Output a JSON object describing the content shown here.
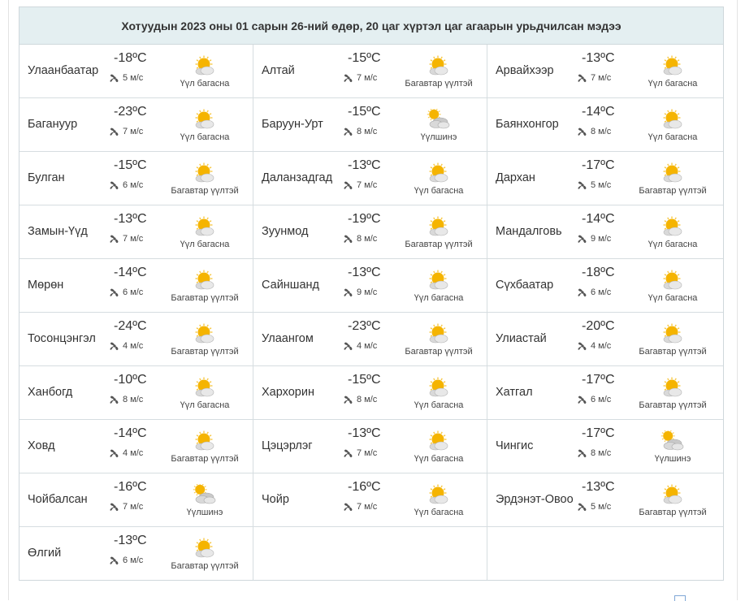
{
  "title": "Хотуудын 2023 оны 01 сарын 26-ний өдөр, 20 цаг хүртэл цаг агаарын урьдчилсан мэдээ",
  "cities": [
    {
      "name": "Улаанбаатар",
      "temp": "-18ºC",
      "wind": "5 м/с",
      "desc": "Үүл багасна",
      "icon": "sun-cloud-icon"
    },
    {
      "name": "Алтай",
      "temp": "-15ºC",
      "wind": "7 м/с",
      "desc": "Багавтар үүлтэй",
      "icon": "sun-cloud-icon"
    },
    {
      "name": "Арвайхээр",
      "temp": "-13ºC",
      "wind": "7 м/с",
      "desc": "Үүл багасна",
      "icon": "sun-cloud-icon"
    },
    {
      "name": "Баганууp",
      "temp": "-23ºC",
      "wind": "7 м/с",
      "desc": "Үүл багасна",
      "icon": "sun-cloud-icon"
    },
    {
      "name": "Баруун-Урт",
      "temp": "-15ºC",
      "wind": "8 м/с",
      "desc": "Үүлшинэ",
      "icon": "cloudy-icon"
    },
    {
      "name": "Баянхонгор",
      "temp": "-14ºC",
      "wind": "8 м/с",
      "desc": "Үүл багасна",
      "icon": "sun-cloud-icon"
    },
    {
      "name": "Булган",
      "temp": "-15ºC",
      "wind": "6 м/с",
      "desc": "Багавтар үүлтэй",
      "icon": "sun-cloud-icon"
    },
    {
      "name": "Даланзадгад",
      "temp": "-13ºC",
      "wind": "7 м/с",
      "desc": "Үүл багасна",
      "icon": "sun-cloud-icon"
    },
    {
      "name": "Дархан",
      "temp": "-17ºC",
      "wind": "5 м/с",
      "desc": "Багавтар үүлтэй",
      "icon": "sun-cloud-icon"
    },
    {
      "name": "Замын-Үүд",
      "temp": "-13ºC",
      "wind": "7 м/с",
      "desc": "Үүл багасна",
      "icon": "sun-cloud-icon"
    },
    {
      "name": "Зуунмод",
      "temp": "-19ºC",
      "wind": "8 м/с",
      "desc": "Багавтар үүлтэй",
      "icon": "sun-cloud-icon"
    },
    {
      "name": "Мандалговь",
      "temp": "-14ºC",
      "wind": "9 м/с",
      "desc": "Үүл багасна",
      "icon": "sun-cloud-icon"
    },
    {
      "name": "Мөрөн",
      "temp": "-14ºC",
      "wind": "6 м/с",
      "desc": "Багавтар үүлтэй",
      "icon": "sun-cloud-icon"
    },
    {
      "name": "Сайншанд",
      "temp": "-13ºC",
      "wind": "9 м/с",
      "desc": "Үүл багасна",
      "icon": "sun-cloud-icon"
    },
    {
      "name": "Сүхбаатар",
      "temp": "-18ºC",
      "wind": "6 м/с",
      "desc": "Үүл багасна",
      "icon": "sun-cloud-icon"
    },
    {
      "name": "Тосонцэнгэл",
      "temp": "-24ºC",
      "wind": "4 м/с",
      "desc": "Багавтар үүлтэй",
      "icon": "sun-cloud-icon"
    },
    {
      "name": "Улаангом",
      "temp": "-23ºC",
      "wind": "4 м/с",
      "desc": "Багавтар үүлтэй",
      "icon": "sun-cloud-icon"
    },
    {
      "name": "Улиастай",
      "temp": "-20ºC",
      "wind": "4 м/с",
      "desc": "Багавтар үүлтэй",
      "icon": "sun-cloud-icon"
    },
    {
      "name": "Ханбогд",
      "temp": "-10ºC",
      "wind": "8 м/с",
      "desc": "Үүл багасна",
      "icon": "sun-cloud-icon"
    },
    {
      "name": "Хархорин",
      "temp": "-15ºC",
      "wind": "8 м/с",
      "desc": "Үүл багасна",
      "icon": "sun-cloud-icon"
    },
    {
      "name": "Хатгал",
      "temp": "-17ºC",
      "wind": "6 м/с",
      "desc": "Багавтар үүлтэй",
      "icon": "sun-cloud-icon"
    },
    {
      "name": "Ховд",
      "temp": "-14ºC",
      "wind": "4 м/с",
      "desc": "Багавтар үүлтэй",
      "icon": "sun-cloud-icon"
    },
    {
      "name": "Цэцэрлэг",
      "temp": "-13ºC",
      "wind": "7 м/с",
      "desc": "Үүл багасна",
      "icon": "sun-cloud-icon"
    },
    {
      "name": "Чингис",
      "temp": "-17ºC",
      "wind": "8 м/с",
      "desc": "Үүлшинэ",
      "icon": "cloudy-icon"
    },
    {
      "name": "Чойбалсан",
      "temp": "-16ºC",
      "wind": "7 м/с",
      "desc": "Үүлшинэ",
      "icon": "cloudy-icon"
    },
    {
      "name": "Чойр",
      "temp": "-16ºC",
      "wind": "7 м/с",
      "desc": "Үүл багасна",
      "icon": "sun-cloud-icon"
    },
    {
      "name": "Эрдэнэт-Овоо",
      "temp": "-13ºC",
      "wind": "5 м/с",
      "desc": "Багавтар үүлтэй",
      "icon": "sun-cloud-icon"
    },
    {
      "name": "Өлгий",
      "temp": "-13ºC",
      "wind": "6 м/с",
      "desc": "Багавтар үүлтэй",
      "icon": "sun-cloud-icon"
    }
  ],
  "colors": {
    "header_bg": "#e4eff1",
    "border": "#d6dde0",
    "sun": "#f5b400",
    "cloud": "#d9d9d9"
  }
}
